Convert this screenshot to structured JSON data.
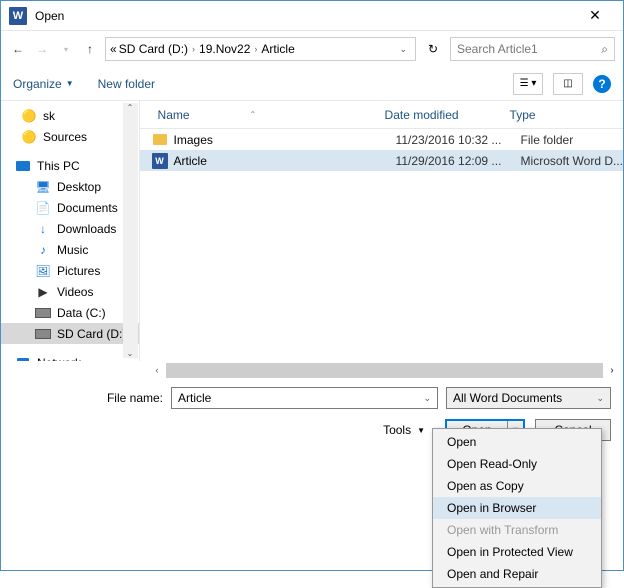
{
  "title": "Open",
  "breadcrumb": {
    "pre": "«",
    "p1": "SD Card (D:)",
    "p2": "19.Nov22",
    "p3": "Article"
  },
  "search": {
    "placeholder": "Search Article1"
  },
  "toolbar": {
    "organize": "Organize",
    "newfolder": "New folder"
  },
  "tree": {
    "sk": "sk",
    "sources": "Sources",
    "thispc": "This PC",
    "desktop": "Desktop",
    "documents": "Documents",
    "downloads": "Downloads",
    "music": "Music",
    "pictures": "Pictures",
    "videos": "Videos",
    "datac": "Data (C:)",
    "sdcard": "SD Card (D:)",
    "network": "Network"
  },
  "columns": {
    "name": "Name",
    "date": "Date modified",
    "type": "Type"
  },
  "files": [
    {
      "name": "Images",
      "date": "11/23/2016 10:32 ...",
      "type": "File folder",
      "kind": "folder"
    },
    {
      "name": "Article",
      "date": "11/29/2016 12:09 ...",
      "type": "Microsoft Word D...",
      "kind": "word"
    }
  ],
  "filename_label": "File name:",
  "filename_value": "Article",
  "filetype": "All Word Documents",
  "tools": "Tools",
  "open_btn": "Open",
  "cancel_btn": "Cancel",
  "dropdown": {
    "open": "Open",
    "readonly": "Open Read-Only",
    "copy": "Open as Copy",
    "browser": "Open in Browser",
    "transform": "Open with Transform",
    "protected": "Open in Protected View",
    "repair": "Open and Repair"
  }
}
